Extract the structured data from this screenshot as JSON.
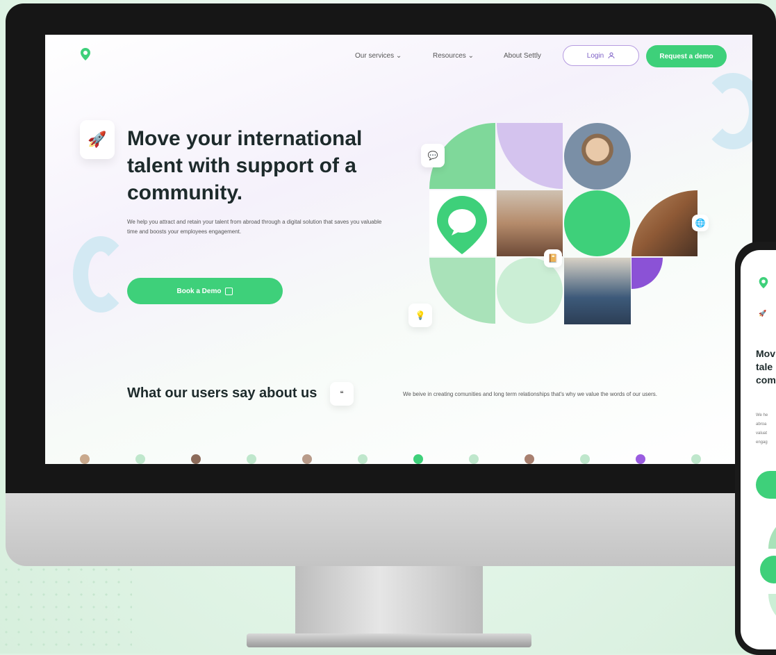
{
  "website": {
    "nav": {
      "items": [
        "Our services",
        "Resources",
        "About Settly"
      ],
      "login_label": "Login",
      "demo_label": "Request a demo"
    },
    "hero": {
      "title": "Move your international talent with support of a community.",
      "subtitle": "We help you attract and retain your talent from abroad through a digital solution that saves you valuable time and boosts your employees engagement.",
      "cta_label": "Book a Demo"
    },
    "testimonials": {
      "title": "What our users say about us",
      "description": "We beive in creating comunities and long term relationships that's why we value the words of our users."
    }
  },
  "phone": {
    "title_lines": [
      "Mov",
      "tale",
      "com"
    ],
    "sub_lines": [
      "We he",
      "abroa",
      "valuat",
      "engag"
    ]
  },
  "colors": {
    "brand_green": "#3ed07a",
    "accent_purple": "#7d5fc6",
    "heading": "#1d2a2b"
  }
}
